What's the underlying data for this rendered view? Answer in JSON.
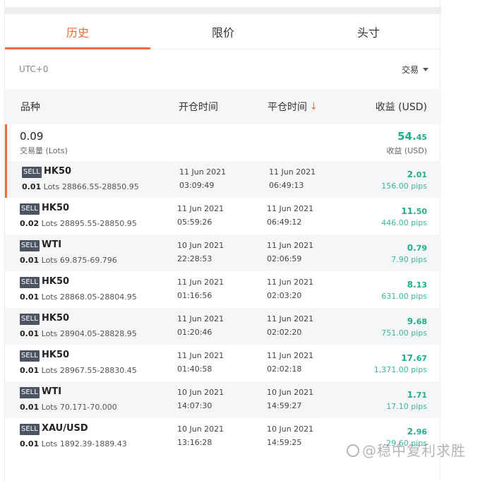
{
  "tabs": [
    {
      "label": "历史",
      "active": true
    },
    {
      "label": "限价",
      "active": false
    },
    {
      "label": "头寸",
      "active": false
    }
  ],
  "subbar": {
    "timezone": "UTC+0",
    "filter_label": "交易"
  },
  "table": {
    "headers": {
      "symbol": "品种",
      "open_time": "开仓时间",
      "close_time": "平仓时间",
      "profit": "收益 (USD)"
    }
  },
  "summary": {
    "volume": "0.09",
    "volume_label": "交易量 (Lots)",
    "profit_main": "54.",
    "profit_dec": "45",
    "profit_label": "收益 (USD)"
  },
  "rows": [
    {
      "side": "SELL",
      "symbol": "HK50",
      "lots": "0.01",
      "lots_unit": "Lots",
      "price": "28866.55-28850.95",
      "open_date": "11 Jun 2021",
      "open_time": "03:09:49",
      "close_date": "11 Jun 2021",
      "close_time": "06:49:13",
      "profit_main": "2.",
      "profit_dec": "01",
      "pips": "156.00 pips"
    },
    {
      "side": "SELL",
      "symbol": "HK50",
      "lots": "0.02",
      "lots_unit": "Lots",
      "price": "28895.55-28850.95",
      "open_date": "11 Jun 2021",
      "open_time": "05:59:26",
      "close_date": "11 Jun 2021",
      "close_time": "06:49:12",
      "profit_main": "11.",
      "profit_dec": "50",
      "pips": "446.00 pips"
    },
    {
      "side": "SELL",
      "symbol": "WTI",
      "lots": "0.01",
      "lots_unit": "Lots",
      "price": "69.875-69.796",
      "open_date": "10 Jun 2021",
      "open_time": "22:28:53",
      "close_date": "11 Jun 2021",
      "close_time": "02:06:59",
      "profit_main": "0.",
      "profit_dec": "79",
      "pips": "7.90 pips"
    },
    {
      "side": "SELL",
      "symbol": "HK50",
      "lots": "0.01",
      "lots_unit": "Lots",
      "price": "28868.05-28804.95",
      "open_date": "11 Jun 2021",
      "open_time": "01:16:56",
      "close_date": "11 Jun 2021",
      "close_time": "02:03:20",
      "profit_main": "8.",
      "profit_dec": "13",
      "pips": "631.00 pips"
    },
    {
      "side": "SELL",
      "symbol": "HK50",
      "lots": "0.01",
      "lots_unit": "Lots",
      "price": "28904.05-28828.95",
      "open_date": "11 Jun 2021",
      "open_time": "01:20:46",
      "close_date": "11 Jun 2021",
      "close_time": "02:02:20",
      "profit_main": "9.",
      "profit_dec": "68",
      "pips": "751.00 pips"
    },
    {
      "side": "SELL",
      "symbol": "HK50",
      "lots": "0.01",
      "lots_unit": "Lots",
      "price": "28967.55-28830.45",
      "open_date": "11 Jun 2021",
      "open_time": "01:40:58",
      "close_date": "11 Jun 2021",
      "close_time": "02:02:18",
      "profit_main": "17.",
      "profit_dec": "67",
      "pips": "1,371.00 pips"
    },
    {
      "side": "SELL",
      "symbol": "WTI",
      "lots": "0.01",
      "lots_unit": "Lots",
      "price": "70.171-70.000",
      "open_date": "10 Jun 2021",
      "open_time": "14:07:30",
      "close_date": "10 Jun 2021",
      "close_time": "14:59:27",
      "profit_main": "1.",
      "profit_dec": "71",
      "pips": "17.10 pips"
    },
    {
      "side": "SELL",
      "symbol": "XAU/USD",
      "lots": "0.01",
      "lots_unit": "Lots",
      "price": "1892.39-1889.43",
      "open_date": "10 Jun 2021",
      "open_time": "13:16:28",
      "close_date": "10 Jun 2021",
      "close_time": "14:59:25",
      "profit_main": "2.",
      "profit_dec": "96",
      "pips": "29.60 pips"
    }
  ],
  "watermark": {
    "text": "@稳中复利求胜"
  },
  "colors": {
    "accent": "#f26b3a",
    "profit": "#1fae8c",
    "side_badge": "#4d5563"
  }
}
